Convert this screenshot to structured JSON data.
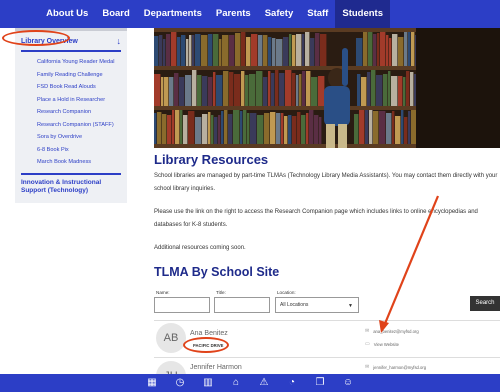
{
  "topnav": {
    "items": [
      "About Us",
      "Board",
      "Departments",
      "Parents",
      "Safety",
      "Staff",
      "Students"
    ],
    "active": "Students"
  },
  "sidebar": {
    "overview_label": "Library Overview",
    "overview_arrow_icon": "down-arrow-icon",
    "links": [
      "California Young Reader Medal",
      "Family Reading Challenge",
      "FSD Book Read Alouds",
      "Place a Hold in Researcher",
      "Research Companion",
      "Research Companion (STAFF)",
      "Sora by Overdrive",
      "6-8 Book Pix",
      "March Book Madness"
    ],
    "innovation_label": "Innovation & Instructional Support (Technology)"
  },
  "content": {
    "library_heading": "Library Resources",
    "para1": "School libraries are managed by part-time TLMAs (Technology Library Media Assistants).  You may contact them directly with your school library inquiries.",
    "para2": "Please use the link on the right to access the Research Companion page which includes links to online encyclopedias and databases for K-8 students.",
    "para3": "Additional resources coming soon.",
    "tlma_heading": "TLMA By School Site"
  },
  "filters": {
    "name_label": "Name:",
    "title_label": "Title:",
    "location_label": "Location:",
    "location_value": "All Locations",
    "search_label": "Search"
  },
  "people": [
    {
      "initials": "AB",
      "name": "Ana Benitez",
      "school": "PACIFIC DRIVE",
      "email": "ana_benitez@myfsd.org",
      "website": "View Website"
    },
    {
      "initials": "JH",
      "name": "Jennifer Harmon",
      "email": "jennifer_harmon@myfsd.org"
    }
  ],
  "bottombar": {
    "icons": [
      "calendar-icon",
      "clock-icon",
      "book-icon",
      "bank-icon",
      "alert-icon",
      "pie-icon",
      "book-open-icon",
      "users-icon"
    ]
  },
  "colors": {
    "nav_blue": "#2c3ec6",
    "heading_blue": "#1e2a8a",
    "annotation_red": "#e0431a"
  }
}
